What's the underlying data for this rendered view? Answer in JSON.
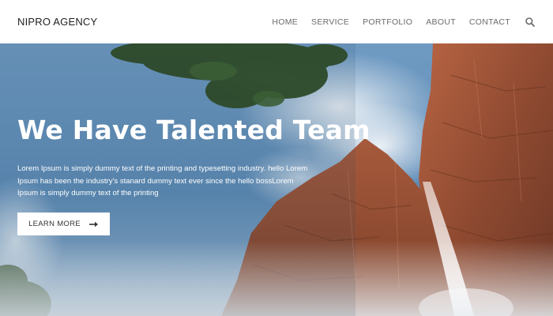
{
  "header": {
    "brand": "NIPRO AGENCY",
    "nav": [
      "HOME",
      "SERVICE",
      "PORTFOLIO",
      "ABOUT",
      "CONTACT"
    ],
    "search_icon": "search-icon"
  },
  "hero": {
    "title": "We Have Talented Team",
    "text": "Lorem Ipsum is simply dummy text of the printing and typesetting industry. hello Lorem Ipsum has been the industry's stanard dummy text ever since the hello bossLorem Ipsum is simply dummy text of the printing",
    "cta_label": "LEARN MORE",
    "cta_icon": "arrow-right-icon"
  },
  "colors": {
    "header_bg": "#ffffff",
    "nav_text": "#6b6b6b",
    "brand_text": "#1f1f1f",
    "hero_text": "#ffffff",
    "sky": "#5f8fb8",
    "rock": "#9a4f33"
  }
}
